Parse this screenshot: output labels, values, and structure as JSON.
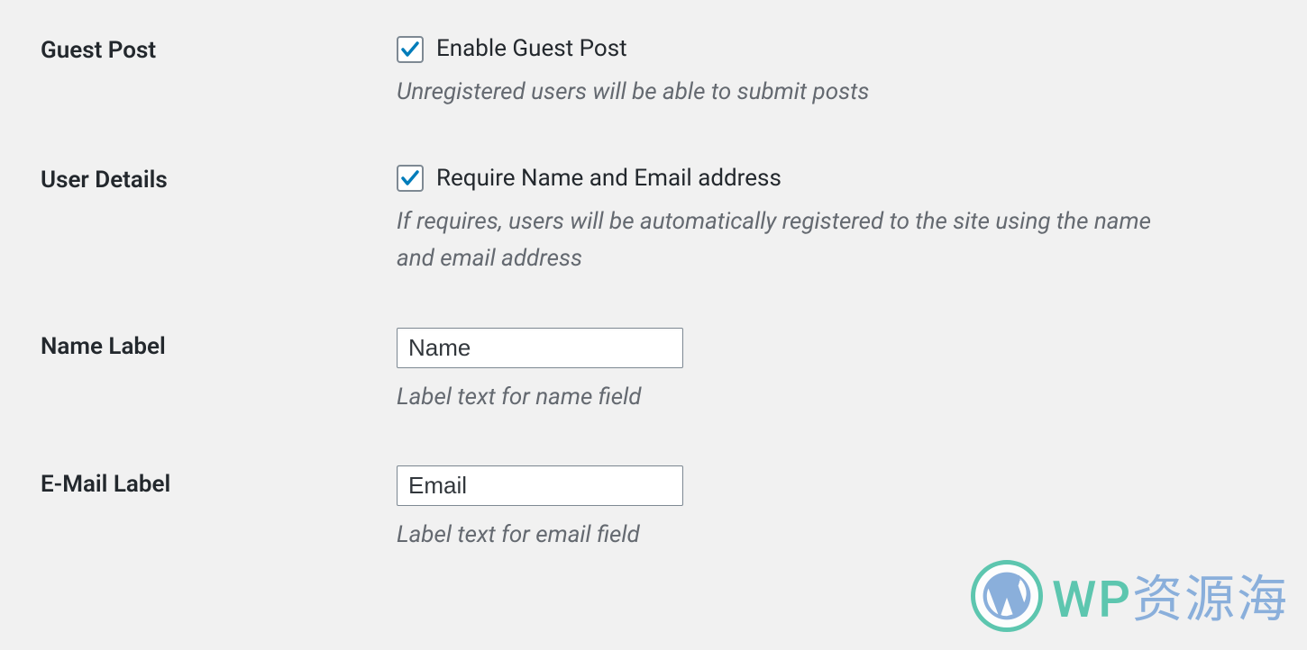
{
  "settings": {
    "guest_post": {
      "row_label": "Guest Post",
      "checkbox_label": "Enable Guest Post",
      "checked": true,
      "description": "Unregistered users will be able to submit posts"
    },
    "user_details": {
      "row_label": "User Details",
      "checkbox_label": "Require Name and Email address",
      "checked": true,
      "description": "If requires, users will be automatically registered to the site using the name and email address"
    },
    "name_label": {
      "row_label": "Name Label",
      "value": "Name",
      "description": "Label text for name field"
    },
    "email_label": {
      "row_label": "E-Mail Label",
      "value": "Email",
      "description": "Label text for email field"
    }
  },
  "watermark": {
    "text_left": "WP",
    "text_right": "资源海"
  },
  "colors": {
    "check": "#007cba",
    "desc": "#646970",
    "wm_green": "#4ec2a8",
    "wm_blue": "#7fa8d9"
  }
}
